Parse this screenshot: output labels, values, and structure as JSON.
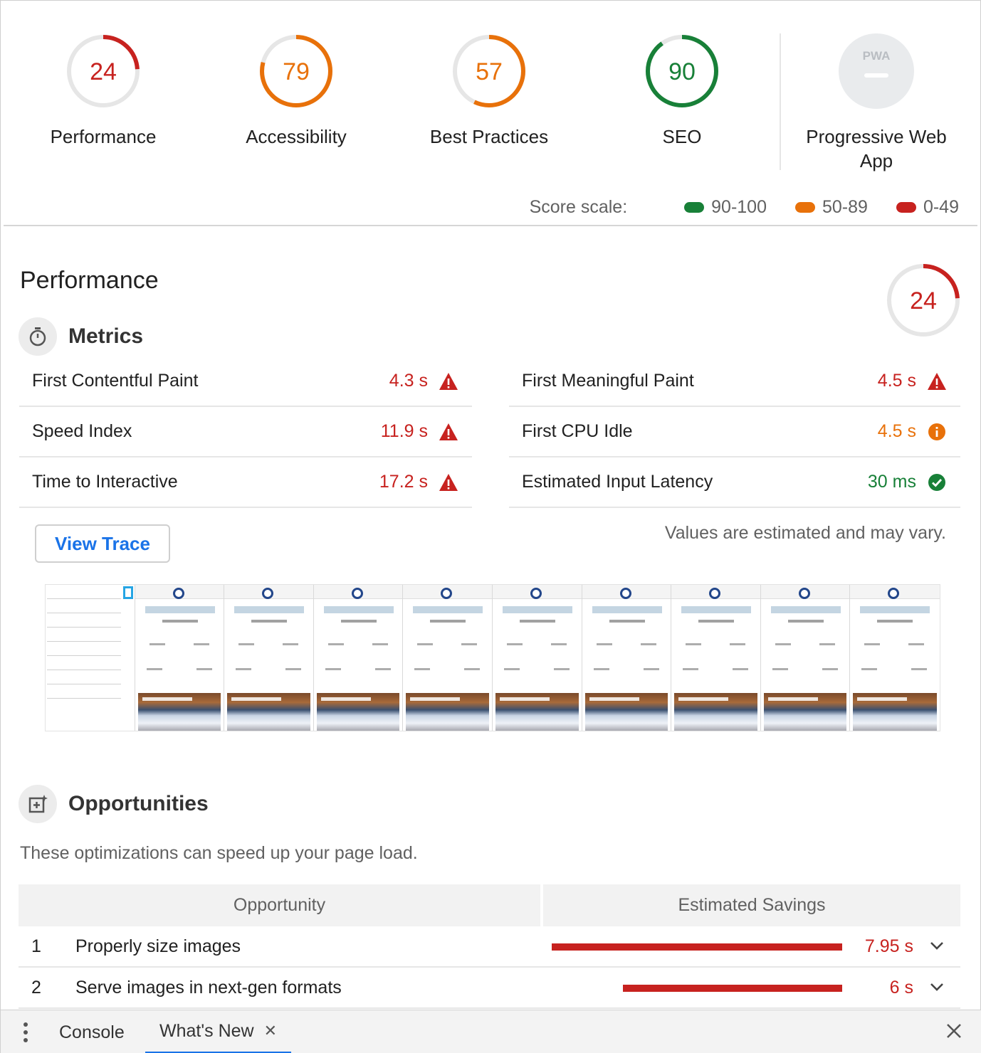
{
  "scores": [
    {
      "label": "Performance",
      "value": "24",
      "level": "fail"
    },
    {
      "label": "Accessibility",
      "value": "79",
      "level": "average"
    },
    {
      "label": "Best Practices",
      "value": "57",
      "level": "average"
    },
    {
      "label": "SEO",
      "value": "90",
      "level": "pass"
    }
  ],
  "pwa": {
    "label": "Progressive Web App",
    "badge": "PWA"
  },
  "score_scale": {
    "label": "Score scale:",
    "ranges": [
      {
        "label": "90-100",
        "color": "#188038"
      },
      {
        "label": "50-89",
        "color": "#e8710a"
      },
      {
        "label": "0-49",
        "color": "#c7221f"
      }
    ]
  },
  "colors": {
    "pass": "#188038",
    "average": "#e8710a",
    "fail": "#c7221f",
    "accent": "#1a73e8"
  },
  "performance": {
    "title": "Performance",
    "score": "24",
    "metrics_title": "Metrics",
    "metrics_left": [
      {
        "name": "First Contentful Paint",
        "value": "4.3 s",
        "status": "fail",
        "icon": "warning-triangle-icon"
      },
      {
        "name": "Speed Index",
        "value": "11.9 s",
        "status": "fail",
        "icon": "warning-triangle-icon"
      },
      {
        "name": "Time to Interactive",
        "value": "17.2 s",
        "status": "fail",
        "icon": "warning-triangle-icon"
      }
    ],
    "metrics_right": [
      {
        "name": "First Meaningful Paint",
        "value": "4.5 s",
        "status": "fail",
        "icon": "warning-triangle-icon"
      },
      {
        "name": "First CPU Idle",
        "value": "4.5 s",
        "status": "average",
        "icon": "info-circle-icon"
      },
      {
        "name": "Estimated Input Latency",
        "value": "30 ms",
        "status": "pass",
        "icon": "check-circle-icon"
      }
    ],
    "view_trace_label": "View Trace",
    "estimate_note": "Values are estimated and may vary."
  },
  "opportunities": {
    "title": "Opportunities",
    "description": "These optimizations can speed up your page load.",
    "headers": [
      "Opportunity",
      "Estimated Savings"
    ],
    "rows": [
      {
        "num": "1",
        "label": "Properly size images",
        "savings": "7.95 s",
        "seconds": 7.95
      },
      {
        "num": "2",
        "label": "Serve images in next-gen formats",
        "savings": "6 s",
        "seconds": 6
      }
    ]
  },
  "drawer": {
    "tabs": [
      {
        "label": "Console",
        "active": false
      },
      {
        "label": "What's New",
        "active": true
      }
    ]
  }
}
